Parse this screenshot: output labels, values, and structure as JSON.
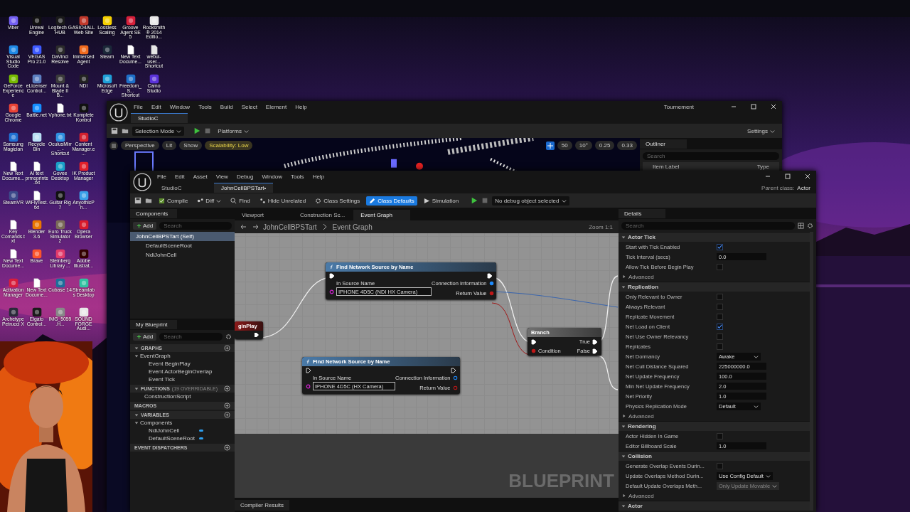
{
  "desktop": {
    "wallpaper": {
      "kind": "picture"
    },
    "icon_rows": [
      [
        {
          "label": "Viber",
          "kind": "app",
          "color": "#7360f2"
        },
        {
          "label": "Unreal Engine",
          "kind": "app",
          "color": "#111111"
        },
        {
          "label": "Logitech G HUB",
          "kind": "app",
          "color": "#1a1a1a"
        },
        {
          "label": "ASIO4ALL Web Site",
          "kind": "app",
          "color": "#c0392b"
        },
        {
          "label": "Lossless Scaling",
          "kind": "app",
          "color": "#f5d000"
        },
        {
          "label": "Groove Agent SE 5",
          "kind": "app",
          "color": "#d6203a"
        },
        {
          "label": "Rocksmith® 2014 Editio...",
          "kind": "app",
          "color": "#e8e8e8"
        }
      ],
      [
        {
          "label": "Visual Studio Code",
          "kind": "app",
          "color": "#1e88e5"
        },
        {
          "label": "VEGAS Pro 21.0",
          "kind": "app",
          "color": "#3d5afe"
        },
        {
          "label": "DaVinci Resolve",
          "kind": "app",
          "color": "#2b2b2b"
        },
        {
          "label": "Immersed Agent",
          "kind": "app",
          "color": "#f06a1d"
        },
        {
          "label": "Steam",
          "kind": "app",
          "color": "#1b2838"
        },
        {
          "label": "New Text Docume...",
          "kind": "file",
          "color": "#ffffff"
        },
        {
          "label": "webui-user... Shortcut",
          "kind": "file",
          "color": "#e6e6e6"
        }
      ],
      [
        {
          "label": "GeForce Experience",
          "kind": "app",
          "color": "#76b900"
        },
        {
          "label": "eLicenser Control...",
          "kind": "app",
          "color": "#5c7fc0"
        },
        {
          "label": "Mount & Blade II B...",
          "kind": "app",
          "color": "#3a3a3a"
        },
        {
          "label": "NDI",
          "kind": "app",
          "color": "#222222"
        },
        {
          "label": "Microsoft Edge",
          "kind": "app",
          "color": "#1fa0d8"
        },
        {
          "label": "Freedom_S... Shortcut",
          "kind": "app",
          "color": "#1e6fc7"
        },
        {
          "label": "Camo Studio",
          "kind": "app",
          "color": "#5a32d8"
        }
      ],
      [
        {
          "label": "Google Chrome",
          "kind": "app",
          "color": "#e94335"
        },
        {
          "label": "Battle.net",
          "kind": "app",
          "color": "#148eff"
        },
        {
          "label": "Vphone.txt",
          "kind": "file",
          "color": "#ffffff"
        },
        {
          "label": "Komplete Kontrol",
          "kind": "app",
          "color": "#111111"
        }
      ],
      [
        {
          "label": "Samsung Magician",
          "kind": "app",
          "color": "#1f6fd1"
        },
        {
          "label": "Recycle Bin",
          "kind": "app",
          "color": "#b9dff5"
        },
        {
          "label": "OculusMirr... - Shortcut",
          "kind": "app",
          "color": "#2f8fe0"
        },
        {
          "label": "Content Manager.e...",
          "kind": "app",
          "color": "#d3202e"
        }
      ],
      [
        {
          "label": "New Text Docume...",
          "kind": "file",
          "color": "#ffffff"
        },
        {
          "label": "AI text prmoprints.txt",
          "kind": "file",
          "color": "#ffffff"
        },
        {
          "label": "Govee Desktop",
          "kind": "app",
          "color": "#19a0c8"
        },
        {
          "label": "IK Product Manager",
          "kind": "app",
          "color": "#e0202a"
        }
      ],
      [
        {
          "label": "SteamVR",
          "kind": "app",
          "color": "#3c4a8a"
        },
        {
          "label": "WiFlyTest.txt",
          "kind": "file",
          "color": "#ffffff"
        },
        {
          "label": "Guitar Rig 7",
          "kind": "app",
          "color": "#111111"
        },
        {
          "label": "AnyothicPh...",
          "kind": "app",
          "color": "#3aa0e8"
        }
      ],
      [
        {
          "label": "Key Comands.txt",
          "kind": "file",
          "color": "#ffffff"
        },
        {
          "label": "Blender 3.6",
          "kind": "app",
          "color": "#ea7600"
        },
        {
          "label": "Euro Truck Simulator 2",
          "kind": "app",
          "color": "#7a6a58"
        },
        {
          "label": "Opera Browser",
          "kind": "app",
          "color": "#d81b2c"
        }
      ],
      [
        {
          "label": "New Text Docume...",
          "kind": "file",
          "color": "#ffffff"
        },
        {
          "label": "Brave",
          "kind": "app",
          "color": "#fb542b"
        },
        {
          "label": "Steinberg Library ...",
          "kind": "app",
          "color": "#e23a6a"
        },
        {
          "label": "Adobe Illustrat...",
          "kind": "app",
          "color": "#330000"
        }
      ],
      [
        {
          "label": "Activation Manager",
          "kind": "app",
          "color": "#d81e3c"
        },
        {
          "label": "New Text Docume...",
          "kind": "file",
          "color": "#ffffff"
        },
        {
          "label": "Cubase 14",
          "kind": "app",
          "color": "#1c6e9a"
        },
        {
          "label": "Streamlabs Desktop",
          "kind": "app",
          "color": "#31c3a2"
        }
      ],
      [
        {
          "label": "Archetype Petrucci X",
          "kind": "app",
          "color": "#2a2a3a"
        },
        {
          "label": "Elgato Control...",
          "kind": "app",
          "color": "#1a1a1a"
        },
        {
          "label": "IMG_5059.H...",
          "kind": "app",
          "color": "#888888"
        },
        {
          "label": "SOUND FORGE Audi...",
          "kind": "app",
          "color": "#e8e8e8"
        }
      ]
    ]
  },
  "webcam": {
    "kind": "picture"
  },
  "level_editor": {
    "menu": [
      "File",
      "Edit",
      "Window",
      "Tools",
      "Build",
      "Select",
      "Element",
      "Help"
    ],
    "tab": "StudioC",
    "project": "Tournement",
    "toolbar": {
      "mode": "Selection Mode",
      "platforms": "Platforms",
      "settings": "Settings"
    },
    "viewport": {
      "kind": "picture",
      "chips": [
        "Perspective",
        "Lit",
        "Show"
      ],
      "scalability": "Scalability: Low",
      "snaps": [
        "50",
        "10°",
        "0.25",
        "0.33"
      ]
    },
    "outliner": {
      "title": "Outliner",
      "placeholder": "Search",
      "columns": [
        "Item Label",
        "Type"
      ]
    }
  },
  "blueprint_editor": {
    "menu": [
      "File",
      "Edit",
      "Asset",
      "View",
      "Debug",
      "Window",
      "Tools",
      "Help"
    ],
    "tabs": [
      {
        "label": "StudioC",
        "selected": false
      },
      {
        "label": "JohnCellBPSTart•",
        "selected": true
      }
    ],
    "parent_class": {
      "label": "Parent class:",
      "value": "Actor"
    },
    "toolbar": [
      {
        "label": "Compile",
        "kind": "compile",
        "selected": false
      },
      {
        "label": "Diff",
        "kind": "diff",
        "selected": false
      },
      {
        "label": "Find",
        "kind": "find",
        "selected": false
      },
      {
        "label": "Hide Unrelated",
        "kind": "hide",
        "selected": false
      },
      {
        "label": "Class Settings",
        "kind": "settings",
        "selected": false
      },
      {
        "label": "Class Defaults",
        "kind": "defaults",
        "selected": true
      },
      {
        "label": "Simulation",
        "kind": "simulation",
        "selected": false
      }
    ],
    "debug_object": "No debug object selected",
    "components": {
      "title": "Components",
      "add": "Add",
      "placeholder": "Search",
      "tree": [
        {
          "label": "JohnCellBPSTart (Self)",
          "selected": true,
          "children": [
            {
              "label": "DefaultSceneRoot",
              "selected": false
            },
            {
              "label": "NdiJohnCell",
              "selected": false
            }
          ]
        }
      ]
    },
    "my_blueprint": {
      "title": "My Blueprint",
      "add": "Add",
      "placeholder": "Search",
      "sections": [
        {
          "title": "GRAPHS",
          "items": [
            {
              "label": "EventGraph",
              "children": [
                {
                  "label": "Event BeginPlay"
                },
                {
                  "label": "Event ActorBeginOverlap"
                },
                {
                  "label": "Event Tick"
                }
              ]
            }
          ]
        },
        {
          "title": "FUNCTIONS",
          "note": "(19 OVERRIDABLE)",
          "items": [
            {
              "label": "ConstructionScript"
            }
          ]
        },
        {
          "title": "MACROS"
        },
        {
          "title": "VARIABLES",
          "items": [
            {
              "label": "Components",
              "children": [
                {
                  "label": "NdiJohnCell",
                  "kind": "variable"
                },
                {
                  "label": "DefaultSceneRoot",
                  "kind": "variable"
                }
              ]
            }
          ]
        },
        {
          "title": "EVENT DISPATCHERS"
        }
      ]
    },
    "graph": {
      "tabs": [
        {
          "label": "Viewport",
          "selected": false
        },
        {
          "label": "Construction Sc...",
          "selected": false
        },
        {
          "label": "Event Graph",
          "selected": true
        }
      ],
      "breadcrumb": [
        "JohnCellBPSTart",
        "Event Graph"
      ],
      "zoom": "Zoom 1:1",
      "watermark": "BLUEPRINT",
      "nodes": [
        {
          "kind": "event",
          "title": "ginPlay"
        },
        {
          "kind": "function",
          "title": "Find Network Source by Name",
          "input_label": "In Source Name",
          "input_value": "IPHONE 4D5C (NDI HX Camera)",
          "outputs": [
            "Connection Information",
            "Return Value"
          ],
          "connected": true
        },
        {
          "kind": "function",
          "title": "Find Network Source by Name",
          "input_label": "In Source Name",
          "input_value": "IPHONE 4D5C (HX Camera)",
          "outputs": [
            "Connection Information",
            "Return Value"
          ],
          "connected": false
        },
        {
          "kind": "branch",
          "title": "Branch",
          "input_label": "Condition",
          "outputs": [
            "True",
            "False"
          ],
          "connected": true
        }
      ]
    },
    "details": {
      "title": "Details",
      "placeholder": "Search",
      "categories": [
        {
          "title": "Actor Tick",
          "rows": [
            {
              "label": "Start with Tick Enabled",
              "kind": "checkbox",
              "checked": true
            },
            {
              "label": "Tick Interval (secs)",
              "kind": "number",
              "value": "0.0"
            },
            {
              "label": "Allow Tick Before Begin Play",
              "kind": "checkbox",
              "checked": false
            }
          ],
          "advanced": "Advanced"
        },
        {
          "title": "Replication",
          "rows": [
            {
              "label": "Only Relevant to Owner",
              "kind": "checkbox",
              "checked": false
            },
            {
              "label": "Always Relevant",
              "kind": "checkbox",
              "checked": false
            },
            {
              "label": "Replicate Movement",
              "kind": "checkbox",
              "checked": false
            },
            {
              "label": "Net Load on Client",
              "kind": "checkbox",
              "checked": true
            },
            {
              "label": "Net Use Owner Relevancy",
              "kind": "checkbox",
              "checked": false
            },
            {
              "label": "Replicates",
              "kind": "checkbox",
              "checked": false
            },
            {
              "label": "Net Dormancy",
              "kind": "dropdown",
              "value": "Awake",
              "disabled": false
            },
            {
              "label": "Net Cull Distance Squared",
              "kind": "number",
              "value": "225000000.0"
            },
            {
              "label": "Net Update Frequency",
              "kind": "number",
              "value": "100.0"
            },
            {
              "label": "Min Net Update Frequency",
              "kind": "number",
              "value": "2.0"
            },
            {
              "label": "Net Priority",
              "kind": "number",
              "value": "1.0"
            },
            {
              "label": "Physics Replication Mode",
              "kind": "dropdown",
              "value": "Default",
              "disabled": false
            }
          ],
          "advanced": "Advanced"
        },
        {
          "title": "Rendering",
          "rows": [
            {
              "label": "Actor Hidden In Game",
              "kind": "checkbox",
              "checked": false
            },
            {
              "label": "Editor Billboard Scale",
              "kind": "number",
              "value": "1.0"
            }
          ]
        },
        {
          "title": "Collision",
          "rows": [
            {
              "label": "Generate Overlap Events Durin...",
              "kind": "checkbox",
              "checked": false
            },
            {
              "label": "Update Overlaps Method Durin...",
              "kind": "dropdown",
              "value": "Use Config Default",
              "disabled": false
            },
            {
              "label": "Default Update Overlaps Meth...",
              "kind": "dropdown",
              "value": "Only Update Movable",
              "disabled": true
            }
          ],
          "advanced": "Advanced"
        },
        {
          "title": "Actor"
        }
      ]
    },
    "bottom_tab": "Compiler Results"
  }
}
